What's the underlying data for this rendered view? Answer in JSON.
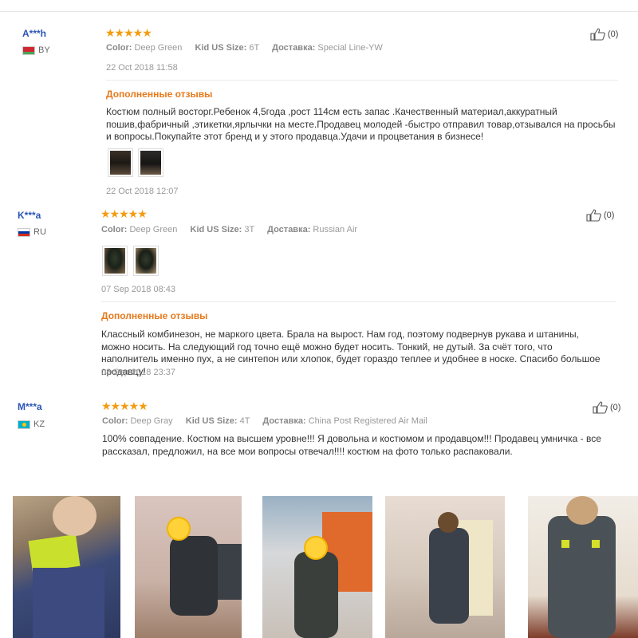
{
  "reviews": [
    {
      "user": "A***h",
      "country": "BY",
      "stars": "★★★★★",
      "color_label": "Color:",
      "color_value": "Deep Green",
      "size_label": "Kid US Size:",
      "size_value": "6T",
      "ship_label": "Доставка:",
      "ship_value": "Special Line-YW",
      "date": "22 Oct 2018 11:58",
      "additional_title": "Дополненные отзывы",
      "additional_text": "Костюм полный восторг.Ребенок 4,5года ,рост 114см есть запас .Качественный материал,аккуратный пошив,фабричный ,этикетки,ярлычки на месте.Продавец молодей -быстро отправил товар,отзывался на просьбы и вопросы.Покупайте этот бренд и у этого продавца.Удачи и процветания в бизнесе!",
      "additional_date": "22 Oct 2018 12:07",
      "helpful": "(0)"
    },
    {
      "user": "K***a",
      "country": "RU",
      "stars": "★★★★★",
      "color_label": "Color:",
      "color_value": "Deep Green",
      "size_label": "Kid US Size:",
      "size_value": "3T",
      "ship_label": "Доставка:",
      "ship_value": "Russian Air",
      "date": "07 Sep 2018 08:43",
      "additional_title": "Дополненные отзывы",
      "additional_text": "Классный комбинезон, не маркого цвета. Брала на вырост. Нам год, поэтому подвернув рукава и штанины, можно носить. На следующий год точно ещё можно будет носить. Тонкий, не дутый. За счёт того, что наполнитель именно пух, а не синтепон или хлопок, будет гораздо теплее и удобнее в носке. Спасибо большое продавцу!",
      "additional_date": "08 Sep 2018 23:37",
      "helpful": "(0)"
    },
    {
      "user": "M***a",
      "country": "KZ",
      "stars": "★★★★★",
      "color_label": "Color:",
      "color_value": "Deep Gray",
      "size_label": "Kid US Size:",
      "size_value": "4T",
      "ship_label": "Доставка:",
      "ship_value": "China Post Registered Air Mail",
      "text": "100% совпадение. Костюм на высшем уровне!!! Я довольна и костюмом и продавцом!!! Продавец умничка - все рассказал, предложил, на все мои вопросы отвечал!!!! костюм на фото только распаковали.",
      "helpful": "(0)"
    }
  ],
  "colors": {
    "star": "#f39c12",
    "username": "#2a55b6",
    "additional_title": "#e5791b"
  },
  "icons": {
    "helpful": "thumbs-up-icon",
    "star": "star-icon"
  }
}
